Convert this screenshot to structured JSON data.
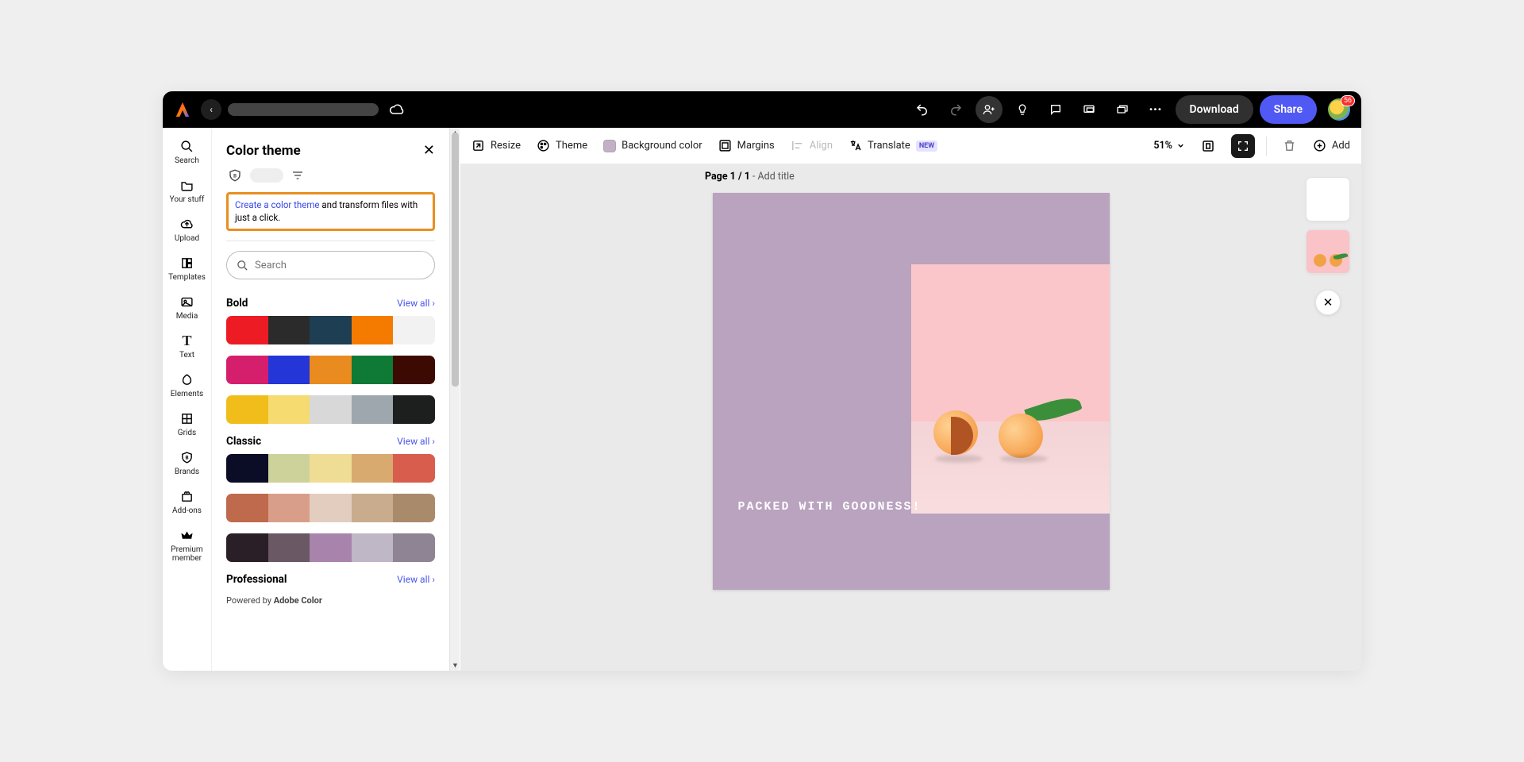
{
  "header": {
    "download": "Download",
    "share": "Share",
    "notif_count": "56"
  },
  "rail": {
    "search": "Search",
    "your_stuff": "Your stuff",
    "upload": "Upload",
    "templates": "Templates",
    "media": "Media",
    "text": "Text",
    "elements": "Elements",
    "grids": "Grids",
    "brands": "Brands",
    "addons": "Add-ons",
    "premium": "Premium member"
  },
  "panel": {
    "title": "Color theme",
    "callout_link": "Create a color theme",
    "callout_rest": " and transform files with just a click.",
    "search_placeholder": "Search",
    "view_all": "View all ›",
    "sections": {
      "bold": "Bold",
      "classic": "Classic",
      "professional": "Professional"
    },
    "powered_pre": "Powered by ",
    "powered_brand": "Adobe Color",
    "palettes": {
      "bold1": [
        "#ed1c24",
        "#2b2b2b",
        "#1d3e53",
        "#f47b00",
        "#f2f2f2"
      ],
      "bold2": [
        "#d61f6c",
        "#2436d8",
        "#e98b1f",
        "#0f7a35",
        "#3d0a03"
      ],
      "bold3": [
        "#f0bd1b",
        "#f5db70",
        "#d8d8d8",
        "#9ea7ae",
        "#1d1f1f"
      ],
      "classic1": [
        "#0b0d27",
        "#cdd29a",
        "#f0dd95",
        "#d8aa6f",
        "#d85d4d"
      ],
      "classic2": [
        "#bf6a4c",
        "#d99e8a",
        "#e3cdbe",
        "#c9ac8d",
        "#a98a6b"
      ],
      "classic3": [
        "#2a1f26",
        "#6a5865",
        "#a884ad",
        "#bfb6c6",
        "#8e8494"
      ]
    }
  },
  "toolbar": {
    "resize": "Resize",
    "theme": "Theme",
    "bgcolor": "Background color",
    "margins": "Margins",
    "align": "Align",
    "translate": "Translate",
    "new": "NEW",
    "zoom": "51%",
    "add": "Add"
  },
  "canvas": {
    "page_label_bold": "Page 1 / 1",
    "page_label_rest": " - Add title",
    "caption": "PACKED WITH GOODNESS!"
  }
}
